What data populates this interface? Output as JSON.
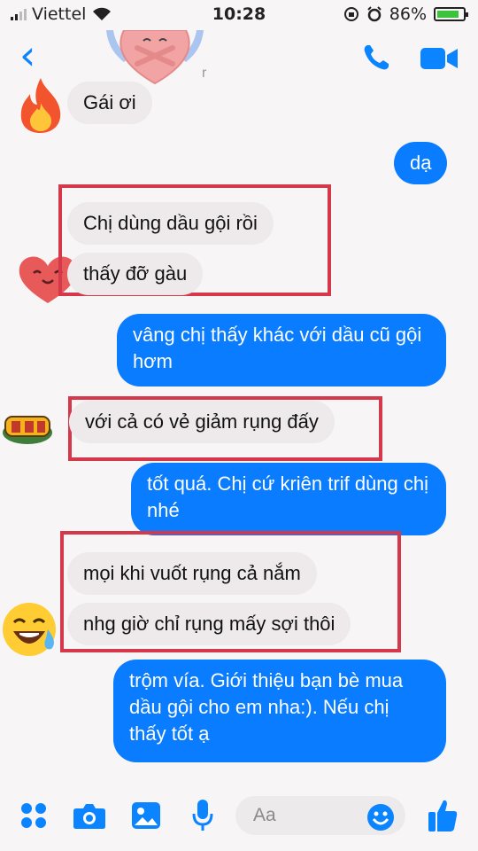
{
  "status_bar": {
    "carrier": "Viettel",
    "time": "10:28",
    "battery": "86%",
    "battery_level": 0.86
  },
  "header": {
    "contact_name_partial": "r",
    "back_icon": "chevron-left-icon",
    "call_icon": "phone-icon",
    "video_icon": "video-camera-icon"
  },
  "messages": [
    {
      "side": "in",
      "text": "Gái ơi"
    },
    {
      "side": "out",
      "text": "dạ"
    },
    {
      "side": "in",
      "text": "Chị dùng dầu gội rồi"
    },
    {
      "side": "in",
      "text": "thấy đỡ gàu"
    },
    {
      "side": "out",
      "text": "vâng chị thấy khác với dầu cũ gội hơm"
    },
    {
      "side": "in",
      "text": "với cả có vẻ giảm rụng đấy"
    },
    {
      "side": "out",
      "text": "tốt quá. Chị cứ kriên trif dùng chị nhé"
    },
    {
      "side": "in",
      "text": "mọi khi vuốt rụng cả nắm"
    },
    {
      "side": "in",
      "text": "nhg giờ chỉ rụng mấy sợi thôi"
    },
    {
      "side": "out",
      "text": "trộm vía. Giới thiệu bạn bè mua dầu gội cho em nha:). Nếu chị thấy tốt ạ"
    }
  ],
  "composer": {
    "placeholder": "Aa",
    "icons": [
      "apps-grid-icon",
      "camera-icon",
      "image-icon",
      "microphone-icon",
      "emoji-icon",
      "thumbs-up-icon"
    ]
  },
  "colors": {
    "accent": "#0a7cff",
    "incoming_bubble": "#eeeaec",
    "highlight_box": "#d4384a"
  }
}
